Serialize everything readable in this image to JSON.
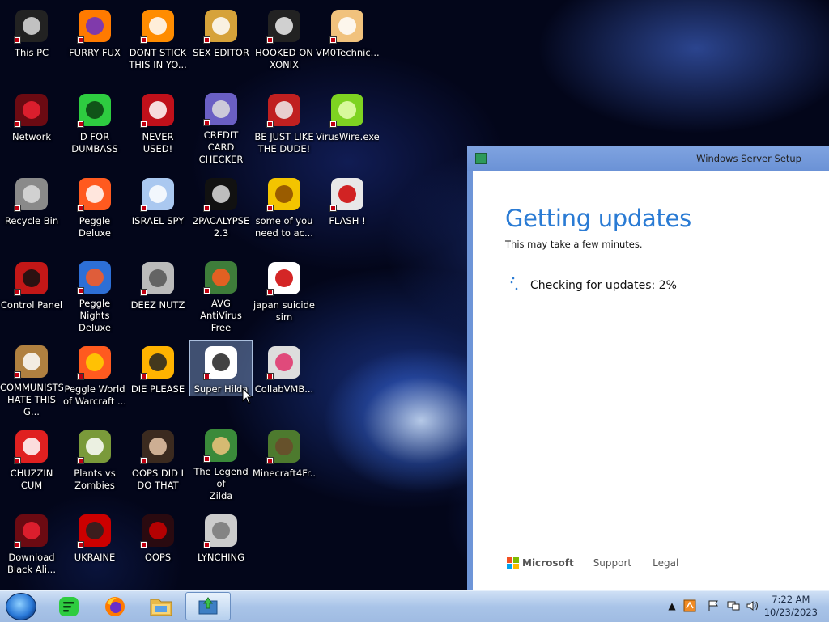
{
  "desktop": {
    "icons": [
      {
        "label": "This PC",
        "icon": "computer-icon",
        "col": 0,
        "row": 0
      },
      {
        "label": "FURRY FUX",
        "icon": "firefox-icon",
        "col": 1,
        "row": 0
      },
      {
        "label": "DONT STICK\nTHIS IN YO...",
        "icon": "vlc-cone-icon",
        "col": 2,
        "row": 0
      },
      {
        "label": "SEX EDITOR",
        "icon": "hxd-editor-icon",
        "col": 3,
        "row": 0
      },
      {
        "label": "HOOKED ON\nXONIX",
        "icon": "xonix-game-icon",
        "col": 4,
        "row": 0
      },
      {
        "label": "VM0Technic...",
        "icon": "technician-icon",
        "col": 5,
        "row": 0
      },
      {
        "label": "Network",
        "icon": "red-orb-icon",
        "col": 0,
        "row": 1
      },
      {
        "label": "D FOR\nDUMBASS",
        "icon": "green-chat-icon",
        "col": 1,
        "row": 1
      },
      {
        "label": "NEVER USED!",
        "icon": "devcpp-icon",
        "col": 2,
        "row": 1
      },
      {
        "label": "CREDIT CARD\nCHECKER",
        "icon": "credit-card-icon",
        "col": 3,
        "row": 1
      },
      {
        "label": "BE JUST LIKE\nTHE DUDE!",
        "icon": "santa-icon",
        "col": 4,
        "row": 1
      },
      {
        "label": "VirusWire.exe",
        "icon": "limewire-icon",
        "col": 5,
        "row": 1
      },
      {
        "label": "Recycle Bin",
        "icon": "recycle-bin-icon",
        "col": 0,
        "row": 2
      },
      {
        "label": "Peggle Deluxe",
        "icon": "peggle-icon",
        "col": 1,
        "row": 2
      },
      {
        "label": "ISRAEL SPY",
        "icon": "network-spy-icon",
        "col": 2,
        "row": 2
      },
      {
        "label": "2PACALYPSE\n2.3",
        "icon": "command-prompt-icon",
        "col": 3,
        "row": 2
      },
      {
        "label": "some of you\nneed to ac...",
        "icon": "beaver-icon",
        "col": 4,
        "row": 2
      },
      {
        "label": "FLASH !",
        "icon": "flash-icon",
        "col": 5,
        "row": 2
      },
      {
        "label": "Control Panel",
        "icon": "control-panel-icon",
        "col": 0,
        "row": 3
      },
      {
        "label": "Peggle Nights\nDeluxe",
        "icon": "peggle-nights-icon",
        "col": 1,
        "row": 3
      },
      {
        "label": "DEEZ NUTZ",
        "icon": "stacked-windows-icon",
        "col": 2,
        "row": 3
      },
      {
        "label": "AVG AntiVirus\nFree",
        "icon": "avg-icon",
        "col": 3,
        "row": 3
      },
      {
        "label": "japan suicide\nsim",
        "icon": "japan-sim-icon",
        "col": 4,
        "row": 3
      },
      {
        "label": "COMMUNISTS\nHATE THIS G...",
        "icon": "money-bag-icon",
        "col": 0,
        "row": 4
      },
      {
        "label": "Peggle World\nof Warcraft ...",
        "icon": "peggle-wow-icon",
        "col": 1,
        "row": 4
      },
      {
        "label": "DIE PLEASE",
        "icon": "de-app-icon",
        "col": 2,
        "row": 4
      },
      {
        "label": "Super Hilda",
        "icon": "pixel-dog-icon",
        "col": 3,
        "row": 4,
        "selected": true
      },
      {
        "label": "CollabVMB...",
        "icon": "monitor-icon",
        "col": 4,
        "row": 4
      },
      {
        "label": "CHUZZIN\nCUM",
        "icon": "chuzzle-icon",
        "col": 0,
        "row": 5
      },
      {
        "label": "Plants vs\nZombies",
        "icon": "pvz-icon",
        "col": 1,
        "row": 5
      },
      {
        "label": "OOPS DID I\nDO THAT",
        "icon": "portrait-icon",
        "col": 2,
        "row": 5
      },
      {
        "label": "The Legend of\nZilda",
        "icon": "zelda-icon",
        "col": 3,
        "row": 5
      },
      {
        "label": "Minecraft4Fr...",
        "icon": "minecraft-icon",
        "col": 4,
        "row": 5
      },
      {
        "label": "Download\nBlack Ali...",
        "icon": "red-orb-icon",
        "col": 0,
        "row": 6
      },
      {
        "label": "UKRAINE",
        "icon": "radiation-icon",
        "col": 1,
        "row": 6
      },
      {
        "label": "OOPS",
        "icon": "dark-app-icon",
        "col": 2,
        "row": 6
      },
      {
        "label": "LYNCHING",
        "icon": "rope-icon",
        "col": 3,
        "row": 6
      }
    ]
  },
  "setup": {
    "window_title": "Windows Server Setup",
    "heading": "Getting updates",
    "subtitle": "This may take a few minutes.",
    "status": "Checking for updates: 2%",
    "progress_percent": 2,
    "footer": {
      "brand": "Microsoft",
      "support": "Support",
      "legal": "Legal"
    },
    "colors": {
      "heading": "#2a7bd4",
      "titlebar": "#6e95d8",
      "ms_red": "#f25022",
      "ms_green": "#7fba00",
      "ms_blue": "#00a4ef",
      "ms_yellow": "#ffb900"
    }
  },
  "taskbar": {
    "buttons": [
      "start-orb",
      "green-chat-app",
      "firefox",
      "file-explorer",
      "windows-setup"
    ],
    "active_button": "windows-setup",
    "tray": {
      "time": "7:22 AM",
      "date": "10/23/2023"
    }
  }
}
